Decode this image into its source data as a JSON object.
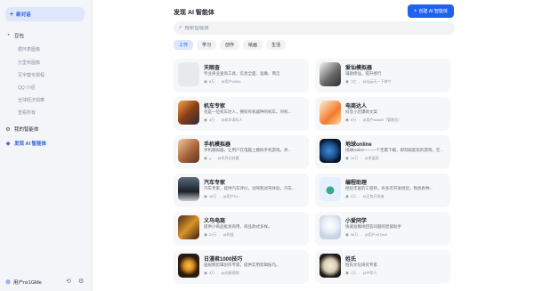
{
  "sidebar": {
    "new_chat_label": "新对话",
    "items": [
      {
        "label": "豆包",
        "icon": "doubao-icon"
      },
      {
        "label": "我的智能体",
        "icon": "bot-icon"
      },
      {
        "label": "发现 AI 智能体",
        "icon": "discover-icon"
      }
    ],
    "sub_items": [
      "循环表图像",
      "万里布图像",
      "写字模专撰程",
      "QQ 介绍",
      "全球经济观察",
      "查看所有"
    ],
    "user": {
      "name": "用户nx1GMe",
      "avatar_text": "用"
    }
  },
  "main": {
    "title": "发现 AI 智能体",
    "create_button": "创建 AI 智能体",
    "search_placeholder": "搜索智能体",
    "tabs": [
      "工作",
      "学习",
      "创作",
      "绘画",
      "生活"
    ]
  },
  "cards": [
    {
      "name": "天眼查",
      "desc": "专业商业查询工具，信息全面、准确、简洁",
      "count": "8万",
      "creator": "@用户b2M4"
    },
    {
      "name": "爱仙模拟器",
      "desc": "辅助修仙，提升修行",
      "count": "7亿",
      "creator": "@仙云天一下修兮"
    },
    {
      "name": "机车专家",
      "desc": "也是一位机车达人，拥有有机器种的机车。对机...",
      "count": "4万",
      "creator": "@机车游玩人"
    },
    {
      "name": "电商达人",
      "desc": "抖音小店爆款文案",
      "count": "8万",
      "creator": "@用户dokolit（管理员）"
    },
    {
      "name": "手机模拟器",
      "desc": "手机模拟器，让用户在电脑上模拟手机游戏。并...",
      "count": "9",
      "creator": "@优作谷技藏"
    },
    {
      "name": "地球online",
      "desc": "地球online——一个无需下载，即刻就能玩的游戏，在...",
      "count": "24万",
      "creator": "@多爱愿"
    },
    {
      "name": "汽车专家",
      "desc": "汽车专家，提供汽车评价，试驾和试驾体验，汽车...",
      "count": "16万",
      "creator": "@用户Dt..."
    },
    {
      "name": "编程助理",
      "desc": "经验丰富的工程师，有多年开发经验，熟悉各种...",
      "count": "3万",
      "creator": "@豆包开发者"
    },
    {
      "name": "义乌电商",
      "desc": "提供小商品批发商用，商品款式多样。",
      "count": "23万",
      "creator": "@利益"
    },
    {
      "name": "小爱同学",
      "desc": "快速准确地回答问题的智能助手",
      "count": "56万",
      "creator": "@用户vKTaxd"
    },
    {
      "name": "日漫君1000技巧",
      "desc": "短视频剪辑创作专家，提供实用剪辑技巧。",
      "count": "3万",
      "creator": "@创意视频"
    },
    {
      "name": "姓氏",
      "desc": "姓氏文化研究专家",
      "count": "1万",
      "creator": "@中华人"
    }
  ],
  "colors": {
    "accent": "#1f62f0",
    "sidebar_bg": "#f3f5f9",
    "card_bg": "#f6f7f9"
  }
}
